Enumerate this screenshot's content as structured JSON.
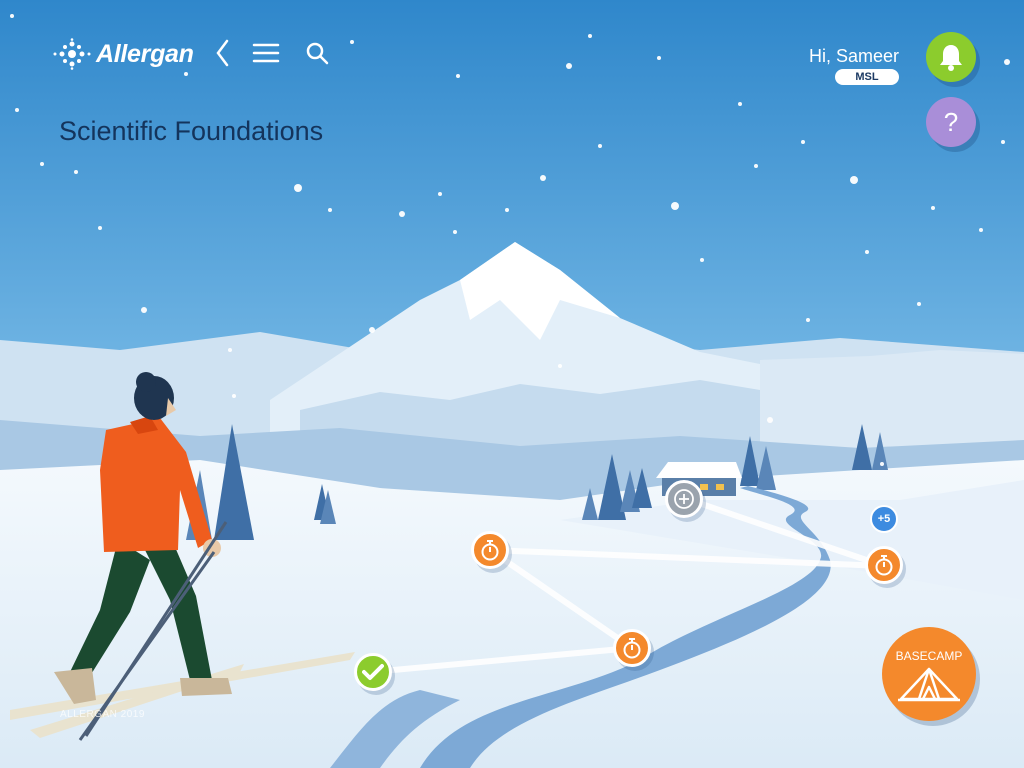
{
  "header": {
    "brand": "Allergan",
    "title": "Scientific Foundations"
  },
  "icons": {
    "back": "chevron-left-icon",
    "menu": "hamburger-menu-icon",
    "search": "search-icon",
    "bell": "bell-icon",
    "help": "question-icon",
    "timer": "stopwatch-icon",
    "check": "checkmark-icon",
    "add": "plus-circle-icon",
    "tent": "tent-icon"
  },
  "user": {
    "greeting": "Hi, Sameer",
    "role": "MSL"
  },
  "help": {
    "label": "?"
  },
  "trail": {
    "extra_count": "+5",
    "basecamp_label": "BASECAMP"
  },
  "footer": {
    "copyright": "ALLERGAN 2019"
  },
  "colors": {
    "sky_top": "#2f87cb",
    "sky_bottom": "#cfe7f6",
    "title_text": "#14345c",
    "orange_node": "#f4892c",
    "green_node": "#8ccc2d",
    "grey_node": "#9aa3ad",
    "help_button": "#a98ed8",
    "badge": "#3d8be0",
    "jacket": "#ef5d1e"
  }
}
